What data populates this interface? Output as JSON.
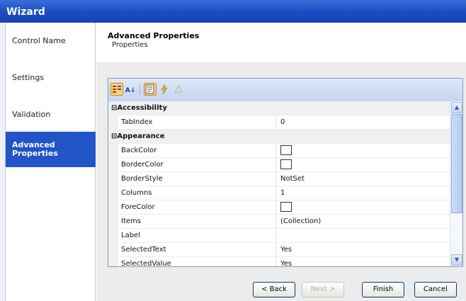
{
  "window": {
    "title": "Wizard"
  },
  "nav": {
    "items": [
      {
        "label": "Control Name"
      },
      {
        "label": "Settings"
      },
      {
        "label": "Validation"
      },
      {
        "label": "Advanced Properties",
        "active": true
      }
    ]
  },
  "header": {
    "title": "Advanced Properties",
    "subtitle": "Properties"
  },
  "toolbar": {
    "buttons": [
      "categorized-icon",
      "alphabetical-icon",
      "properties-icon",
      "events-icon",
      "property-pages-icon"
    ]
  },
  "grid": {
    "rows": [
      {
        "type": "category",
        "name": "Accessibility"
      },
      {
        "type": "property",
        "name": "TabIndex",
        "value": "0"
      },
      {
        "type": "category",
        "name": "Appearance"
      },
      {
        "type": "property",
        "name": "BackColor",
        "value": "",
        "color": true
      },
      {
        "type": "property",
        "name": "BorderColor",
        "value": "",
        "color": true
      },
      {
        "type": "property",
        "name": "BorderStyle",
        "value": "NotSet"
      },
      {
        "type": "property",
        "name": "Columns",
        "value": "1"
      },
      {
        "type": "property",
        "name": "ForeColor",
        "value": "",
        "color": true
      },
      {
        "type": "property",
        "name": "Items",
        "value": "(Collection)"
      },
      {
        "type": "property",
        "name": "Label",
        "value": ""
      },
      {
        "type": "property",
        "name": "SelectedText",
        "value": "Yes"
      },
      {
        "type": "property",
        "name": "SelectedValue",
        "value": "Yes"
      }
    ]
  },
  "buttons": {
    "back": "< Back",
    "next": "Next >",
    "finish": "Finish",
    "cancel": "Cancel"
  },
  "colors": {
    "accent": "#2154c7",
    "title_bar": "#1a4cc0"
  }
}
